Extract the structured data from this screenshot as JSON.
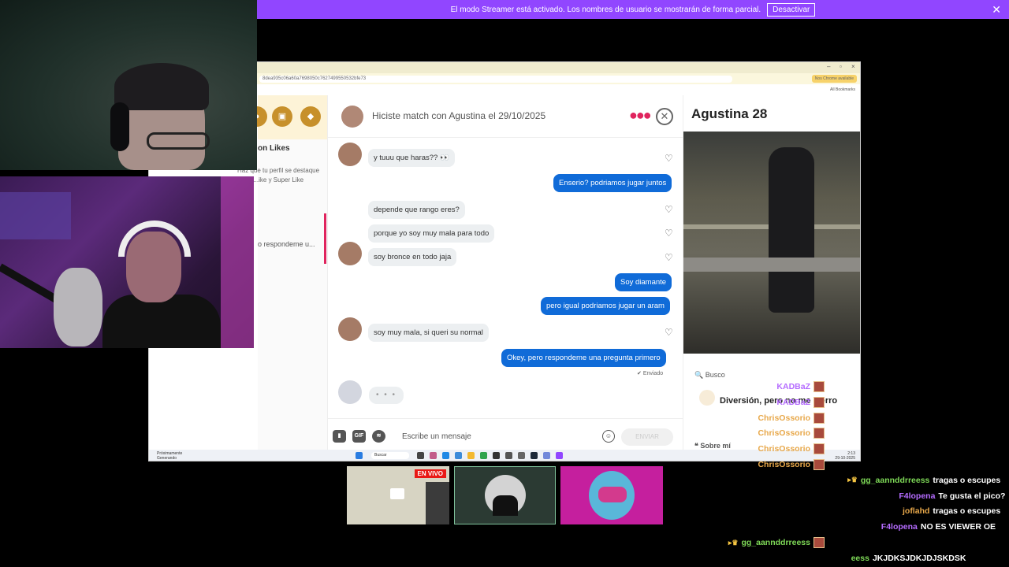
{
  "banner": {
    "text": "El modo Streamer está activado. Los nombres de usuario se mostrarán de forma parcial.",
    "button": "Desactivar",
    "close": "✕"
  },
  "browser": {
    "url": "8dea935c06a60a7698050c7627499550532bfe73",
    "badge": "Nos Chrome available",
    "bookmarks": "All Bookmarks"
  },
  "sidebar": {
    "likes_title": "on Likes",
    "likes_sub": "Haz que tu perfil se destaque entre ...ike y Super Like",
    "preview": "o respondeme u..."
  },
  "chat": {
    "header": "Hiciste match con Agustina el 29/10/2025",
    "messages": [
      {
        "dir": "in",
        "text": "y tuuu que haras?? 👀"
      },
      {
        "dir": "out",
        "text": "Enserio? podriamos jugar juntos"
      },
      {
        "dir": "in",
        "text": "depende que rango eres?"
      },
      {
        "dir": "in",
        "text": "porque yo soy muy mala para todo"
      },
      {
        "dir": "in",
        "text": "soy bronce en todo jaja"
      },
      {
        "dir": "out",
        "text": "Soy diamante"
      },
      {
        "dir": "out",
        "text": "pero igual podriamos jugar un aram"
      },
      {
        "dir": "in",
        "text": "soy muy mala, si queri su normal"
      },
      {
        "dir": "out",
        "text": "Okey, pero respondeme una pregunta primero"
      }
    ],
    "sent_label": "Enviado",
    "typing": "• • •",
    "composer_placeholder": "Escribe un mensaje",
    "gif": "GIF",
    "send": "ENVIAR"
  },
  "profile": {
    "name": "Agustina 28",
    "busco_label": "Busco",
    "busco_value": "Diversión, pero no me cierro",
    "sobre_label": "Sobre mí"
  },
  "taskbar": {
    "news_title": "Próximamente",
    "news_sub": "Generando",
    "search": "Buscar",
    "time": "2:13",
    "date": "29-10-2025"
  },
  "thumbs": {
    "live": "EN VIVO"
  },
  "twitch_chat": [
    {
      "user": "KADBaZ",
      "color": "#b56cff",
      "msg": "",
      "emote": true
    },
    {
      "user": "KADBaZ",
      "color": "#b56cff",
      "msg": "",
      "emote": true
    },
    {
      "user": "ChrisOssorio",
      "color": "#e8a84a",
      "msg": "",
      "emote": true
    },
    {
      "user": "ChrisOssorio",
      "color": "#e8a84a",
      "msg": "",
      "emote": true
    },
    {
      "user": "ChrisOssorio",
      "color": "#e8a84a",
      "msg": "",
      "emote": true
    },
    {
      "user": "ChrisOssorio",
      "color": "#e8a84a",
      "msg": "",
      "emote": true
    },
    {
      "user": "gg_aannddrreess",
      "color": "#7ed957",
      "msg": "tragas o escupes",
      "emote": false,
      "badge": true
    },
    {
      "user": "F4lopena",
      "color": "#b56cff",
      "msg": "Te gusta el pico?",
      "emote": false
    },
    {
      "user": "joflahd",
      "color": "#e8a84a",
      "msg": "tragas o escupes",
      "emote": false
    },
    {
      "user": "F4lopena",
      "color": "#b56cff",
      "msg": "NO ES VIEWER OE",
      "emote": false
    },
    {
      "user": "gg_aannddrreess",
      "color": "#7ed957",
      "msg": "",
      "emote": true,
      "badge": true
    },
    {
      "user": "eess",
      "color": "#7ed957",
      "msg": "JKJDKSJDKJDJSKDSK",
      "emote": false
    }
  ]
}
